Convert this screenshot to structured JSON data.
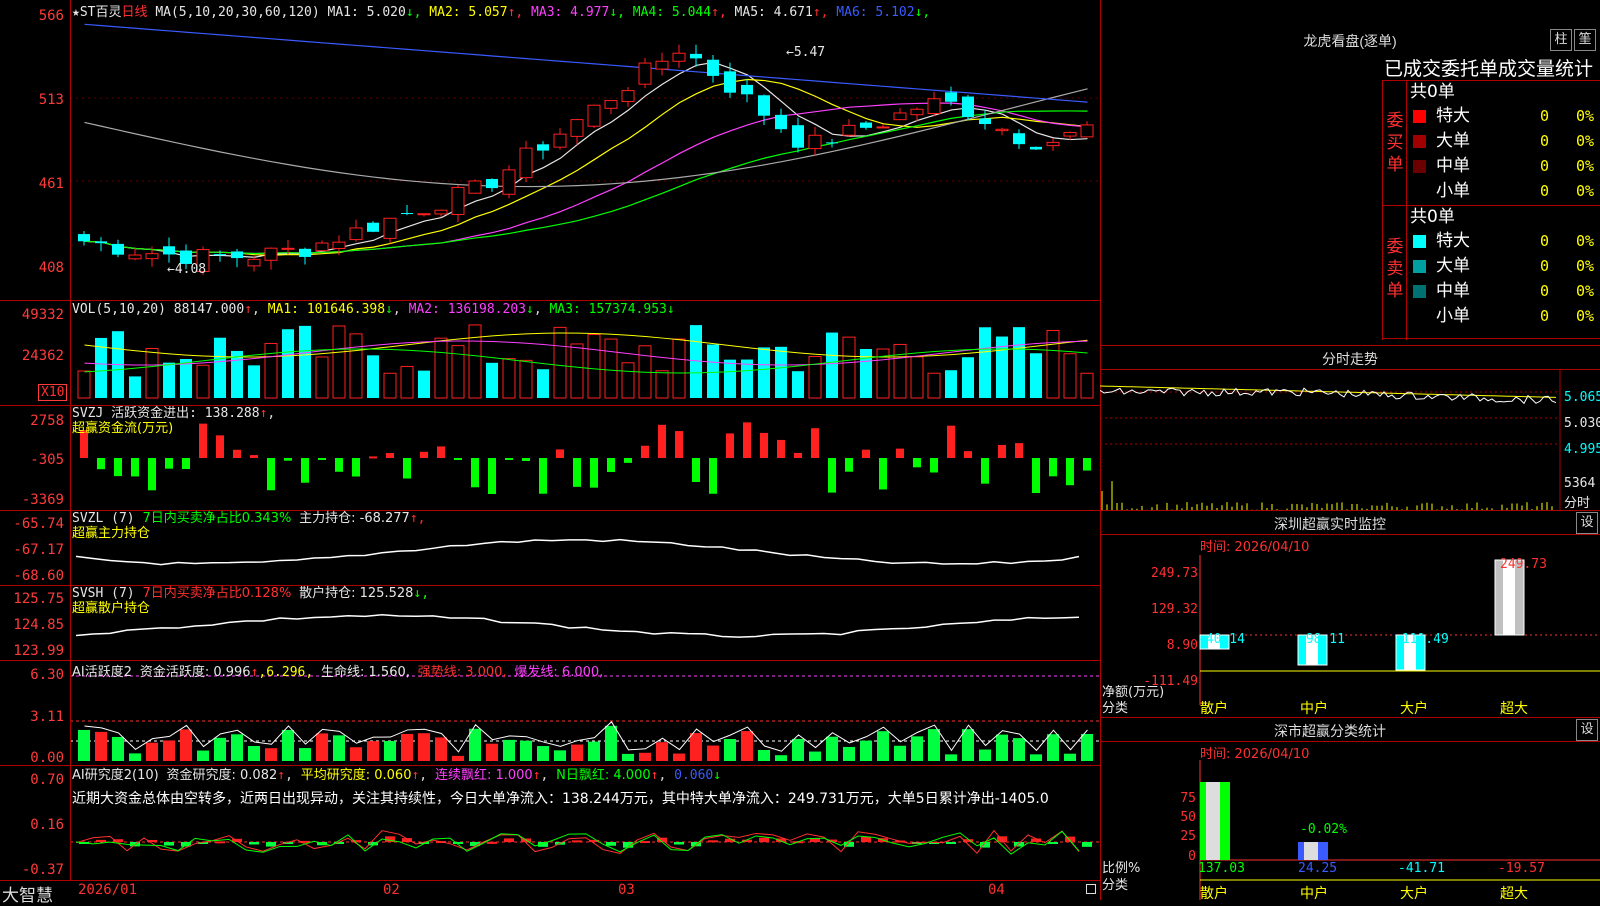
{
  "price_panel": {
    "star": "★",
    "name": "ST百灵",
    "period": "日线",
    "ma_label": "MA(5,10,20,30,60,120)",
    "ma_values": [
      {
        "label": "MA1:",
        "value": "5.020",
        "arrow": "↓",
        "color": "#e6e6e6"
      },
      {
        "label": "MA2:",
        "value": "5.057",
        "arrow": "↑",
        "color": "#ffff00"
      },
      {
        "label": "MA3:",
        "value": "4.977",
        "arrow": "↓",
        "color": "#ff40ff"
      },
      {
        "label": "MA4:",
        "value": "5.044",
        "arrow": "↑",
        "color": "#00ff00"
      },
      {
        "label": "MA5:",
        "value": "4.671",
        "arrow": "↑",
        "color": "#e6e6e6"
      },
      {
        "label": "MA6:",
        "value": "5.102",
        "arrow": "↓",
        "color": "#3a5bff"
      }
    ],
    "y_ticks": [
      "566",
      "513",
      "461",
      "408"
    ],
    "high_note": "5.47",
    "low_note": "4.08"
  },
  "vol_panel": {
    "label": "VOL(5,10,20)",
    "value": "88147.000",
    "value_arrow": "↑",
    "ma1": "MA1: 101646.398",
    "ma1_arrow": "↓",
    "ma2": "MA2: 136198.203",
    "ma2_arrow": "↓",
    "ma3": "MA3: 157374.953",
    "ma3_arrow": "↓",
    "y_ticks": [
      "49332",
      "24362"
    ],
    "unit": "X10"
  },
  "svzj_panel": {
    "line1": "SVZJ  活跃资金进出: 138.288",
    "arrow": "↑",
    "line2": "超赢资金流(万元)",
    "y_ticks": [
      "2758",
      "-305",
      "-3369"
    ]
  },
  "svzl_panel": {
    "name": "SVZL (7)",
    "ratio": "7日内买卖净占比0.343%",
    "hold": "主力持仓: -68.277",
    "arrow": "↑,",
    "line2": "超赢主力持仓",
    "y_ticks": [
      "-65.74",
      "-67.17",
      "-68.60"
    ]
  },
  "svsh_panel": {
    "name": "SVSH (7)",
    "ratio": "7日内买卖净占比0.128%",
    "hold": "散户持仓: 125.528",
    "arrow": "↓,",
    "line2": "超赢散户持仓",
    "y_ticks": [
      "125.75",
      "124.85",
      "123.99"
    ]
  },
  "ai_active_panel": {
    "name": "AI活跃度2",
    "active": "资金活跃度: 0.996",
    "active_arrow": "↑",
    "v2": ",6.296,",
    "life": "生命线: 1.560,",
    "strong": "强势线: 3.000,",
    "burst": "爆发线: 6.000,",
    "y_ticks": [
      "6.30",
      "3.11",
      "0.00"
    ]
  },
  "ai_research_panel": {
    "name": "AI研究度2(10)",
    "research": "资金研究度: 0.082",
    "research_arrow": "↑",
    "avg": "平均研究度: 0.060",
    "avg_arrow": "↑",
    "cont": "连续飘红: 1.000",
    "cont_arrow": "↑",
    "nday": "N日飘红: 4.000",
    "nday_arrow": "↑",
    "extra": "0.060",
    "extra_arrow": "↓",
    "comment": "近期大资金总体由空转多，近两日出现异动，关注其持续性，今日大单净流入：138.244万元，其中特大单净流入：249.731万元，大单5日累计净出-1405.0",
    "y_ticks": [
      "0.70",
      "0.16",
      "-0.37"
    ]
  },
  "bottom_axis": {
    "brand": "大智慧",
    "dates": [
      "2026/01",
      "02",
      "03",
      "04"
    ]
  },
  "dragon_tiger": {
    "title": "龙虎看盘(逐单)",
    "btn1": "柱",
    "btn2": "筀",
    "subtitle": "已成交委托单成交量统计",
    "buy_label": "委买单",
    "sell_label": "委卖单",
    "buy_total": "共0单",
    "sell_total": "共0单",
    "buy_rows": [
      {
        "name": "特大",
        "count": "0",
        "pct": "0%",
        "color": "#ff0000"
      },
      {
        "name": "大单",
        "count": "0",
        "pct": "0%",
        "color": "#a00000"
      },
      {
        "name": "中单",
        "count": "0",
        "pct": "0%",
        "color": "#6a0000"
      },
      {
        "name": "小单",
        "count": "0",
        "pct": "0%",
        "color": "#000000"
      }
    ],
    "sell_rows": [
      {
        "name": "特大",
        "count": "0",
        "pct": "0%",
        "color": "#00ffff"
      },
      {
        "name": "大单",
        "count": "0",
        "pct": "0%",
        "color": "#00a0a0"
      },
      {
        "name": "中单",
        "count": "0",
        "pct": "0%",
        "color": "#007070"
      },
      {
        "name": "小单",
        "count": "0",
        "pct": "0%",
        "color": "#000000"
      }
    ]
  },
  "intraday": {
    "title": "分时走势",
    "price_ticks": [
      "5.065",
      "5.030",
      "4.995"
    ],
    "vol_ticks": [
      "5364",
      "分时"
    ]
  },
  "sz_monitor": {
    "title": "深圳超赢实时监控",
    "btn": "设",
    "time": "时间: 2026/04/10",
    "y_ticks": [
      "249.73",
      "129.32",
      "8.90",
      "-111.49"
    ],
    "ylabel1": "净额(万元)",
    "ylabel2": "分类",
    "categories": [
      "散户",
      "中户",
      "大户",
      "超大"
    ],
    "values": [
      "-40.14",
      "-98.11",
      "-111.49",
      "249.73"
    ]
  },
  "sz_class": {
    "title": "深市超赢分类统计",
    "btn": "设",
    "time": "时间: 2026/04/10",
    "y_ticks": [
      "75",
      "50",
      "25",
      "0"
    ],
    "ylabel1": "比例%",
    "ylabel2": "分类",
    "categories": [
      "散户",
      "中户",
      "大户",
      "超大"
    ],
    "values": [
      "137.03",
      "24.25",
      "-41.71",
      "-19.57"
    ],
    "mid_note": "-0.02%"
  },
  "colors": {
    "up": "#ff2020",
    "down": "#00ffff",
    "grid": "#b00000",
    "axis": "#ff3b3b"
  }
}
